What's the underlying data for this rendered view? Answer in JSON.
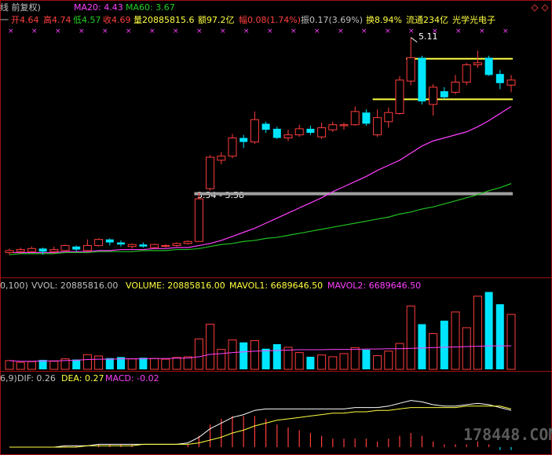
{
  "header": {
    "title_prefix": "线 前复权)",
    "ma20": "MA20: 4.43",
    "ma60": "MA60: 3.67",
    "quote": {
      "dash": "一",
      "open": "开4.64",
      "high": "高4.74",
      "low": "低4.57",
      "close": "收4.69",
      "volume": "量20885815.6",
      "amount": "额97.2亿",
      "change": "幅0.08(1.74%)",
      "amplitude": "振0.17(3.69%)",
      "turnover": "换8.94%",
      "float": "流通234亿",
      "name": "光学光电子"
    }
  },
  "colors": {
    "up": "#ff3c3c",
    "down": "#00e5ff",
    "ma20": "#ff40ff",
    "ma60": "#20c020",
    "yellow": "#ffff40",
    "white": "#ffffff",
    "divider": "#a01010"
  },
  "annotations": {
    "high_label": "5.11",
    "gap_label": "3.54 - 3.58"
  },
  "volume_panel": {
    "params": "0,100)",
    "vvol": "VVOL: 20885816.00",
    "volume": "VOLUME: 20885816.00",
    "mavol1": "MAVOL1: 6689646.50",
    "mavol2": "MAVOL2: 6689646.50"
  },
  "macd_panel": {
    "params": "6,9)",
    "dif": "DIF: 0.26",
    "dea": "DEA: 0.27",
    "macd": "MACD: -0.02"
  },
  "watermark": "178448.COM",
  "chart_data": [
    {
      "type": "candlestick",
      "title": "",
      "ylim": [
        2.8,
        5.2
      ],
      "candles": [
        {
          "o": 2.99,
          "c": 3.01,
          "h": 3.03,
          "l": 2.97
        },
        {
          "o": 3.0,
          "c": 3.02,
          "h": 3.04,
          "l": 2.98
        },
        {
          "o": 3.0,
          "c": 3.03,
          "h": 3.05,
          "l": 2.99
        },
        {
          "o": 3.03,
          "c": 3.0,
          "h": 3.04,
          "l": 2.97
        },
        {
          "o": 3.0,
          "c": 3.02,
          "h": 3.05,
          "l": 2.98
        },
        {
          "o": 3.01,
          "c": 3.06,
          "h": 3.07,
          "l": 3.0
        },
        {
          "o": 3.05,
          "c": 3.02,
          "h": 3.06,
          "l": 3.0
        },
        {
          "o": 3.01,
          "c": 3.06,
          "h": 3.12,
          "l": 3.0
        },
        {
          "o": 3.06,
          "c": 3.12,
          "h": 3.13,
          "l": 3.05
        },
        {
          "o": 3.12,
          "c": 3.09,
          "h": 3.13,
          "l": 3.06
        },
        {
          "o": 3.09,
          "c": 3.07,
          "h": 3.11,
          "l": 3.05
        },
        {
          "o": 3.05,
          "c": 3.07,
          "h": 3.08,
          "l": 3.03
        },
        {
          "o": 3.07,
          "c": 3.05,
          "h": 3.09,
          "l": 3.04
        },
        {
          "o": 3.04,
          "c": 3.07,
          "h": 3.08,
          "l": 3.03
        },
        {
          "o": 3.06,
          "c": 3.06,
          "h": 3.07,
          "l": 3.04
        },
        {
          "o": 3.06,
          "c": 3.08,
          "h": 3.09,
          "l": 3.05
        },
        {
          "o": 3.08,
          "c": 3.1,
          "h": 3.11,
          "l": 3.07
        },
        {
          "o": 3.1,
          "c": 3.52,
          "h": 3.58,
          "l": 3.1
        },
        {
          "o": 3.62,
          "c": 3.93,
          "h": 3.95,
          "l": 3.6
        },
        {
          "o": 3.9,
          "c": 3.94,
          "h": 3.98,
          "l": 3.86
        },
        {
          "o": 3.94,
          "c": 4.12,
          "h": 4.16,
          "l": 3.92
        },
        {
          "o": 4.12,
          "c": 4.08,
          "h": 4.15,
          "l": 4.02
        },
        {
          "o": 4.08,
          "c": 4.3,
          "h": 4.38,
          "l": 4.06
        },
        {
          "o": 4.26,
          "c": 4.2,
          "h": 4.28,
          "l": 4.17
        },
        {
          "o": 4.21,
          "c": 4.12,
          "h": 4.23,
          "l": 4.11
        },
        {
          "o": 4.12,
          "c": 4.15,
          "h": 4.2,
          "l": 4.09
        },
        {
          "o": 4.15,
          "c": 4.21,
          "h": 4.25,
          "l": 4.13
        },
        {
          "o": 4.21,
          "c": 4.17,
          "h": 4.24,
          "l": 4.15
        },
        {
          "o": 4.13,
          "c": 4.22,
          "h": 4.27,
          "l": 4.11
        },
        {
          "o": 4.2,
          "c": 4.25,
          "h": 4.28,
          "l": 4.18
        },
        {
          "o": 4.24,
          "c": 4.25,
          "h": 4.27,
          "l": 4.2
        },
        {
          "o": 4.25,
          "c": 4.38,
          "h": 4.43,
          "l": 4.24
        },
        {
          "o": 4.37,
          "c": 4.26,
          "h": 4.4,
          "l": 4.24
        },
        {
          "o": 4.15,
          "c": 4.32,
          "h": 4.4,
          "l": 4.13
        },
        {
          "o": 4.28,
          "c": 4.37,
          "h": 4.42,
          "l": 4.22
        },
        {
          "o": 4.36,
          "c": 4.69,
          "h": 4.73,
          "l": 4.35
        },
        {
          "o": 4.68,
          "c": 4.91,
          "h": 5.11,
          "l": 4.64
        },
        {
          "o": 4.91,
          "c": 4.48,
          "h": 4.93,
          "l": 4.45
        },
        {
          "o": 4.45,
          "c": 4.62,
          "h": 4.65,
          "l": 4.34
        },
        {
          "o": 4.58,
          "c": 4.52,
          "h": 4.62,
          "l": 4.5
        },
        {
          "o": 4.57,
          "c": 4.67,
          "h": 4.74,
          "l": 4.55
        },
        {
          "o": 4.67,
          "c": 4.84,
          "h": 4.86,
          "l": 4.64
        },
        {
          "o": 4.84,
          "c": 4.86,
          "h": 4.98,
          "l": 4.81
        },
        {
          "o": 4.91,
          "c": 4.74,
          "h": 4.93,
          "l": 4.73
        },
        {
          "o": 4.75,
          "c": 4.66,
          "h": 4.79,
          "l": 4.6
        },
        {
          "o": 4.64,
          "c": 4.69,
          "h": 4.74,
          "l": 4.57
        }
      ],
      "series": [
        {
          "name": "MA20",
          "values": [
            2.99,
            2.99,
            2.99,
            2.99,
            2.99,
            3.0,
            3.0,
            3.0,
            3.01,
            3.01,
            3.02,
            3.02,
            3.02,
            3.03,
            3.03,
            3.04,
            3.04,
            3.06,
            3.08,
            3.11,
            3.15,
            3.19,
            3.23,
            3.28,
            3.33,
            3.38,
            3.43,
            3.48,
            3.53,
            3.59,
            3.64,
            3.69,
            3.74,
            3.8,
            3.85,
            3.9,
            3.97,
            4.04,
            4.09,
            4.12,
            4.15,
            4.18,
            4.23,
            4.29,
            4.36,
            4.43
          ]
        },
        {
          "name": "MA60",
          "values": [
            2.97,
            2.98,
            2.98,
            2.98,
            2.98,
            2.99,
            2.99,
            2.99,
            3.0,
            3.0,
            3.0,
            3.0,
            3.01,
            3.01,
            3.01,
            3.02,
            3.02,
            3.03,
            3.05,
            3.07,
            3.08,
            3.1,
            3.11,
            3.13,
            3.14,
            3.16,
            3.18,
            3.2,
            3.22,
            3.24,
            3.26,
            3.28,
            3.3,
            3.32,
            3.34,
            3.37,
            3.39,
            3.42,
            3.44,
            3.47,
            3.5,
            3.53,
            3.56,
            3.6,
            3.63,
            3.67
          ]
        }
      ],
      "hlines": [
        {
          "y": 4.9,
          "from": 36,
          "to": 45,
          "color": "yellow"
        },
        {
          "y": 4.5,
          "from": 33,
          "to": 45,
          "color": "yellow"
        },
        {
          "y": 3.57,
          "from": 17,
          "to": 45,
          "color": "gray"
        }
      ]
    },
    {
      "type": "bar",
      "title": "VOLUME",
      "ylim": [
        0,
        22000000
      ],
      "values": [
        2500000,
        2000000,
        2200000,
        2700000,
        2300000,
        3000000,
        2800000,
        4200000,
        3800000,
        3200000,
        3500000,
        3000000,
        3300000,
        3100000,
        2900000,
        3400000,
        3600000,
        8700000,
        12900000,
        5700000,
        8400000,
        7700000,
        8200000,
        5900000,
        7200000,
        6300000,
        4800000,
        3600000,
        4100000,
        3600000,
        4500000,
        6200000,
        5600000,
        3900000,
        5200000,
        7400000,
        18100000,
        12900000,
        10200000,
        13900000,
        16400000,
        11900000,
        20900000,
        22100000,
        18600000,
        15700000
      ],
      "series": [
        {
          "name": "MAVOL1",
          "values": [
            2500000,
            2300000,
            2300000,
            2400000,
            2400000,
            2500000,
            2600000,
            2800000,
            2900000,
            2900000,
            3000000,
            3000000,
            3000000,
            3100000,
            3100000,
            3200000,
            3200000,
            3600000,
            4300000,
            4500000,
            4800000,
            5000000,
            5200000,
            5300000,
            5400000,
            5500000,
            5600000,
            5600000,
            5600000,
            5700000,
            5700000,
            5700000,
            5800000,
            5800000,
            5900000,
            5900000,
            6000000,
            6100000,
            6200000,
            6300000,
            6400000,
            6500000,
            6600000,
            6700000,
            6700000,
            6700000
          ]
        }
      ]
    },
    {
      "type": "line",
      "title": "MACD",
      "ylim": [
        -0.05,
        0.45
      ],
      "series": [
        {
          "name": "DIF",
          "values": [
            0.0,
            0.0,
            0.0,
            0.0,
            0.0,
            0.01,
            0.01,
            0.01,
            0.02,
            0.02,
            0.02,
            0.02,
            0.02,
            0.02,
            0.02,
            0.02,
            0.03,
            0.07,
            0.13,
            0.17,
            0.21,
            0.23,
            0.26,
            0.27,
            0.27,
            0.27,
            0.27,
            0.27,
            0.27,
            0.27,
            0.27,
            0.28,
            0.28,
            0.28,
            0.29,
            0.31,
            0.33,
            0.32,
            0.3,
            0.29,
            0.29,
            0.3,
            0.31,
            0.3,
            0.28,
            0.26
          ]
        },
        {
          "name": "DEA",
          "values": [
            0.0,
            0.0,
            0.0,
            0.0,
            0.0,
            0.0,
            0.0,
            0.01,
            0.01,
            0.01,
            0.01,
            0.01,
            0.02,
            0.02,
            0.02,
            0.02,
            0.02,
            0.03,
            0.05,
            0.07,
            0.1,
            0.12,
            0.15,
            0.17,
            0.19,
            0.2,
            0.21,
            0.22,
            0.23,
            0.24,
            0.24,
            0.25,
            0.25,
            0.26,
            0.26,
            0.27,
            0.28,
            0.28,
            0.28,
            0.28,
            0.28,
            0.29,
            0.29,
            0.29,
            0.29,
            0.27
          ]
        }
      ],
      "macd": [
        0.0,
        0.0,
        0.0,
        0.0,
        0.0,
        0.01,
        0.01,
        0.0,
        0.02,
        0.02,
        0.02,
        0.02,
        0.0,
        0.0,
        0.0,
        0.0,
        0.02,
        0.08,
        0.16,
        0.2,
        0.22,
        0.22,
        0.22,
        0.2,
        0.16,
        0.14,
        0.12,
        0.1,
        0.08,
        0.06,
        0.06,
        0.06,
        0.06,
        0.04,
        0.06,
        0.08,
        0.1,
        0.08,
        0.04,
        0.02,
        0.02,
        0.02,
        0.04,
        0.02,
        -0.02,
        -0.02
      ]
    }
  ]
}
